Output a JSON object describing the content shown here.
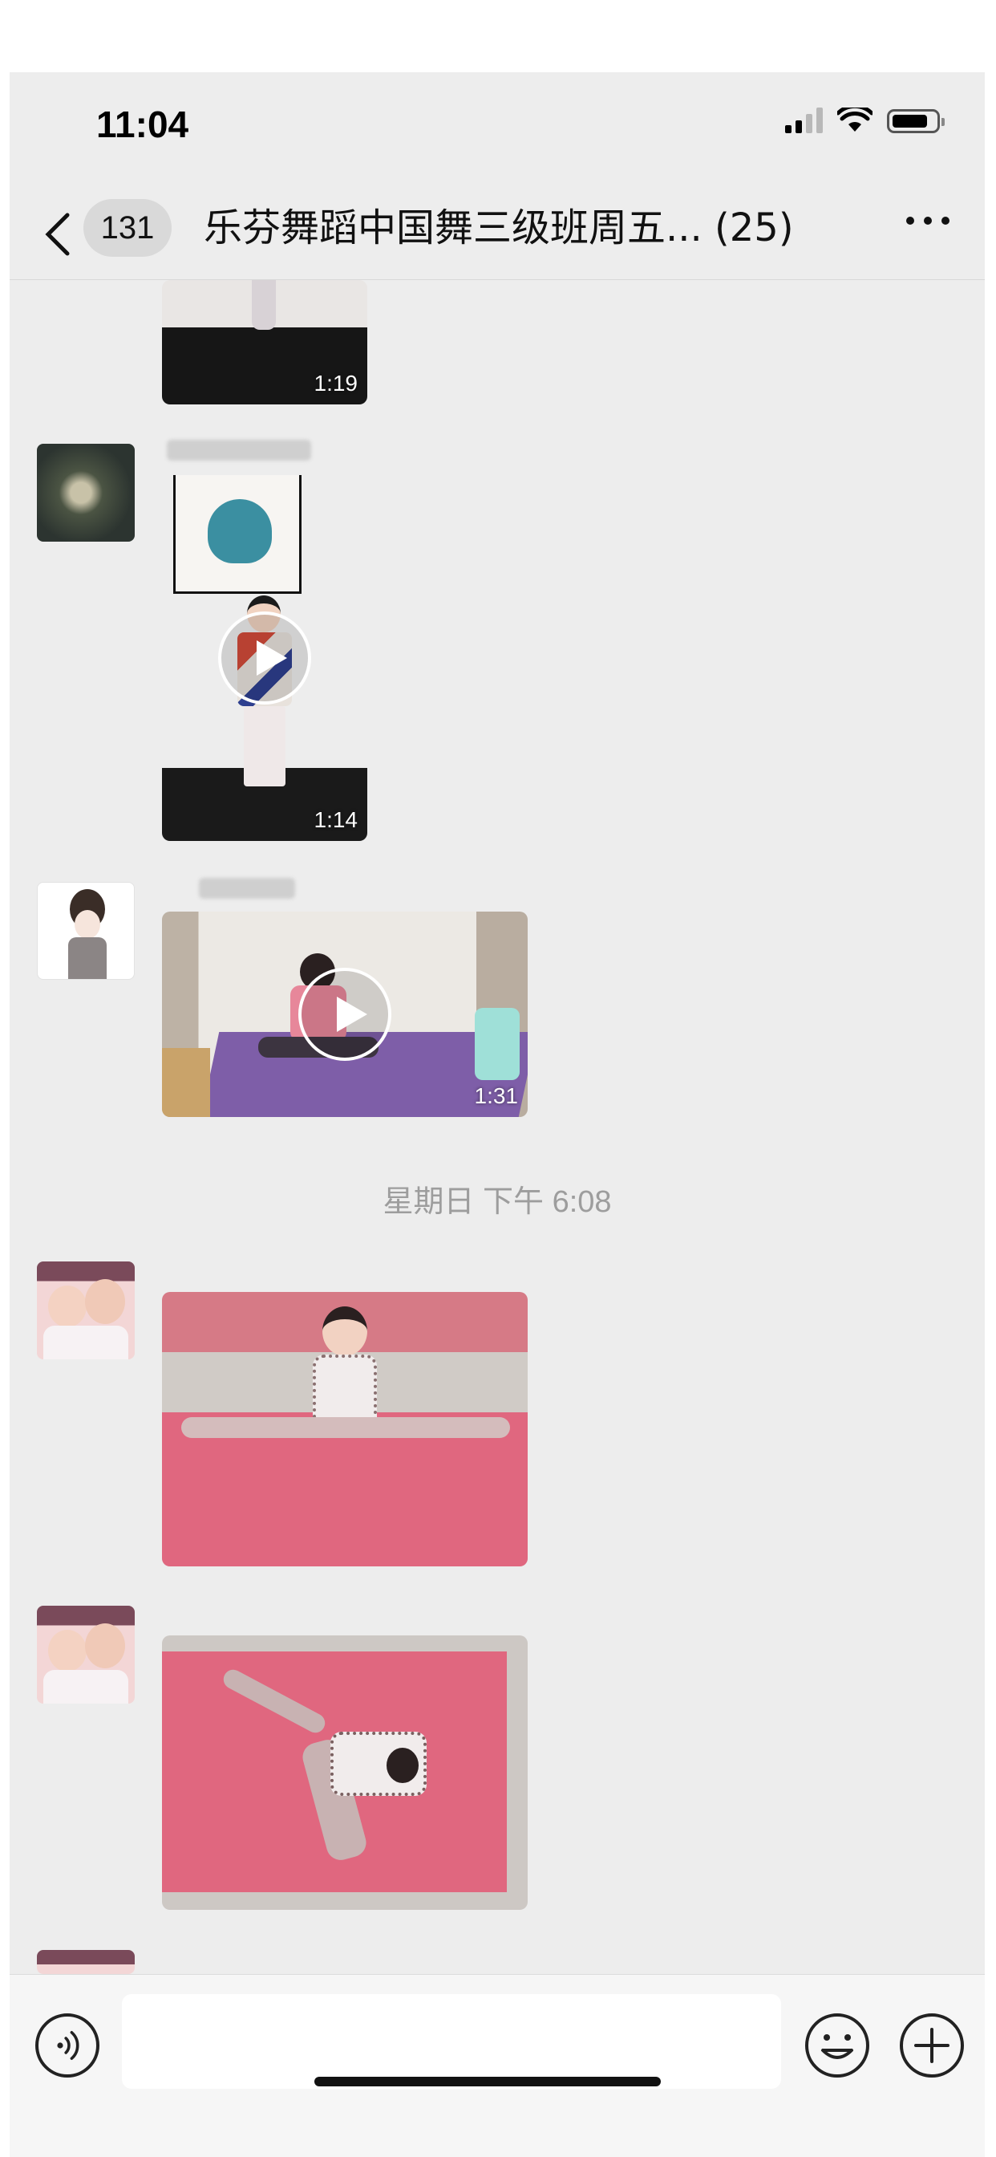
{
  "status_bar": {
    "time": "11:04"
  },
  "header": {
    "unread_count": "131",
    "title": "乐芬舞蹈中国舞三级班周五... (25)"
  },
  "messages": [
    {
      "type": "video",
      "duration": "1:19"
    },
    {
      "type": "video",
      "duration": "1:14"
    },
    {
      "type": "video",
      "duration": "1:31"
    },
    {
      "type": "image"
    },
    {
      "type": "image"
    }
  ],
  "time_divider": "星期日 下午 6:08",
  "input": {
    "value": "",
    "placeholder": ""
  },
  "icons": {
    "back": "chevron-left-icon",
    "more": "more-icon",
    "voice": "voice-icon",
    "emoji": "emoji-icon",
    "plus": "plus-icon",
    "play": "play-icon"
  },
  "colors": {
    "background": "#ededed",
    "mat_pink": "#e0677f",
    "mat_purple": "#7e5ea8"
  }
}
